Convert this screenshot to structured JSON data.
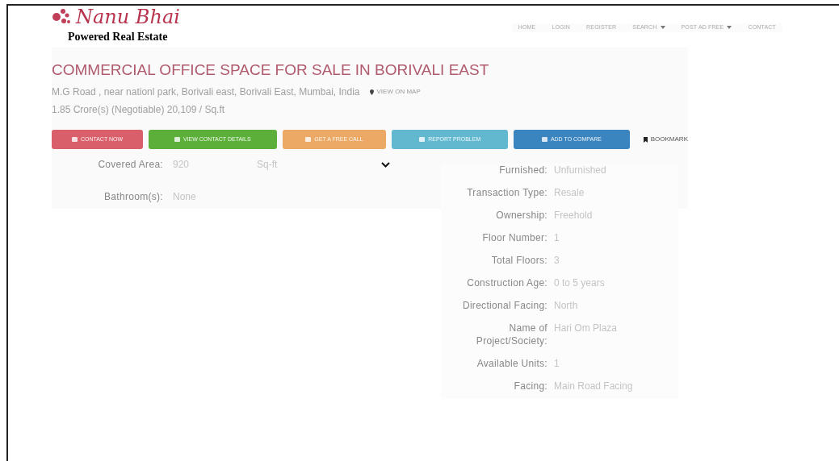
{
  "logo": {
    "name": "Nanu Bhai",
    "tagline": "Powered Real Estate"
  },
  "nav": [
    {
      "label": "HOME",
      "has_menu": false
    },
    {
      "label": "LOGIN",
      "has_menu": false
    },
    {
      "label": "REGISTER",
      "has_menu": false
    },
    {
      "label": "SEARCH",
      "has_menu": true
    },
    {
      "label": "POST AD FREE",
      "has_menu": true
    },
    {
      "label": "CONTACT",
      "has_menu": false
    }
  ],
  "listing": {
    "title": "COMMERCIAL OFFICE SPACE FOR SALE IN BORIVALI EAST",
    "address": "M.G Road , near nationl park, Borivali east, Borivali East, Mumbai, India",
    "map_link": "VIEW ON MAP",
    "price": "1.85 Crore(s) (Negotiable) 20,109 / Sq.ft"
  },
  "actions": [
    {
      "label": "CONTACT NOW",
      "color": "#d9606b"
    },
    {
      "label": "VIEW CONTACT DETAILS",
      "color": "#5cb03a"
    },
    {
      "label": "GET A FREE CALL",
      "color": "#eba965"
    },
    {
      "label": "REPORT PROBLEM",
      "color": "#62b8cf"
    },
    {
      "label": "ADD TO COMPARE",
      "color": "#3a84bf"
    }
  ],
  "bookmark": "BOOKMARK",
  "left_details": [
    {
      "label": "Covered Area:",
      "value": "920",
      "unit": "Sq-ft"
    },
    {
      "label": "Bathroom(s):",
      "value": "None"
    }
  ],
  "right_details": [
    {
      "label": "Furnished:",
      "value": "Unfurnished"
    },
    {
      "label": "Transaction Type:",
      "value": "Resale"
    },
    {
      "label": "Ownership:",
      "value": "Freehold"
    },
    {
      "label": "Floor Number:",
      "value": "1"
    },
    {
      "label": "Total Floors:",
      "value": "3"
    },
    {
      "label": "Construction Age:",
      "value": "0 to 5 years"
    },
    {
      "label": "Directional Facing:",
      "value": "North"
    },
    {
      "label": "Name of Project/Society:",
      "value": "Hari Om Plaza"
    },
    {
      "label": "Available Units:",
      "value": "1"
    },
    {
      "label": "Facing:",
      "value": "Main Road Facing"
    }
  ]
}
